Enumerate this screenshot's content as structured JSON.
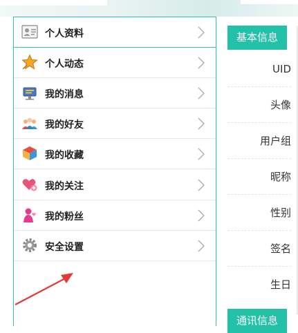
{
  "menu": {
    "items": [
      {
        "label": "个人资料",
        "icon": "profile-card-icon"
      },
      {
        "label": "个人动态",
        "icon": "star-icon"
      },
      {
        "label": "我的消息",
        "icon": "message-icon"
      },
      {
        "label": "我的好友",
        "icon": "friends-icon"
      },
      {
        "label": "我的收藏",
        "icon": "box-icon"
      },
      {
        "label": "我的关注",
        "icon": "heart-plus-icon"
      },
      {
        "label": "我的粉丝",
        "icon": "fan-icon"
      },
      {
        "label": "安全设置",
        "icon": "gear-icon"
      }
    ]
  },
  "panel": {
    "basic_tab": "基本信息",
    "contact_tab": "通讯信息",
    "fields": [
      "UID",
      "头像",
      "用户组",
      "昵称",
      "性别",
      "签名",
      "生日"
    ]
  },
  "colors": {
    "accent": "#22c1a8",
    "border": "#2fc3b0",
    "arrow": "#e53935"
  }
}
